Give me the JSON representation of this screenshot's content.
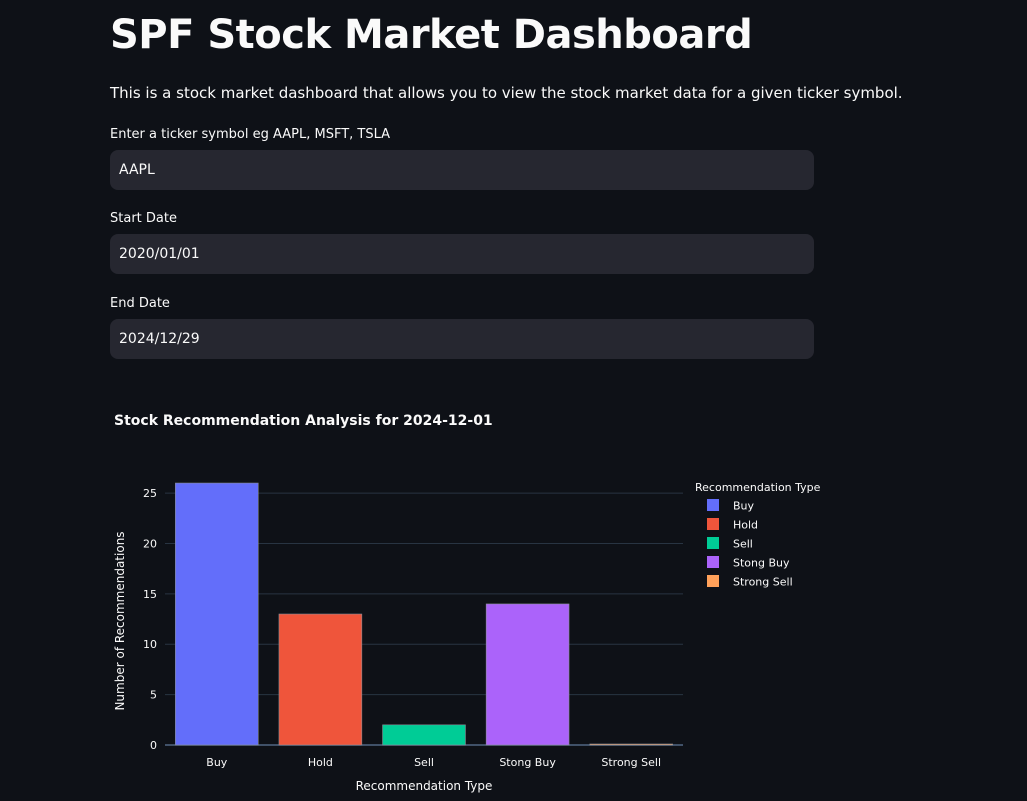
{
  "page": {
    "title": "SPF Stock Market Dashboard",
    "intro": "This is a stock market dashboard that allows you to view the stock market data for a given ticker symbol."
  },
  "form": {
    "ticker": {
      "label": "Enter a ticker symbol eg AAPL, MSFT, TSLA",
      "value": "AAPL"
    },
    "start_date": {
      "label": "Start Date",
      "value": "2020/01/01"
    },
    "end_date": {
      "label": "End Date",
      "value": "2024/12/29"
    }
  },
  "colors": {
    "background": "#0e1117",
    "input_bg": "#262730",
    "grid": "#283442",
    "axis": "#506784"
  },
  "chart_data": {
    "type": "bar",
    "title": "Stock Recommendation Analysis for 2024-12-01",
    "xlabel": "Recommendation Type",
    "ylabel": "Number of Recommendations",
    "categories": [
      "Buy",
      "Hold",
      "Sell",
      "Stong Buy",
      "Strong Sell"
    ],
    "values": [
      26,
      13,
      2,
      14,
      0
    ],
    "colors": [
      "#636efa",
      "#EF553B",
      "#00cc96",
      "#ab63fa",
      "#FFA15A"
    ],
    "ylim": [
      0,
      26.5
    ],
    "yticks": [
      0,
      5,
      10,
      15,
      20,
      25
    ],
    "grid": true,
    "legend": {
      "title": "Recommendation Type",
      "placement": "top-right",
      "entries": [
        "Buy",
        "Hold",
        "Sell",
        "Stong Buy",
        "Strong Sell"
      ]
    }
  }
}
